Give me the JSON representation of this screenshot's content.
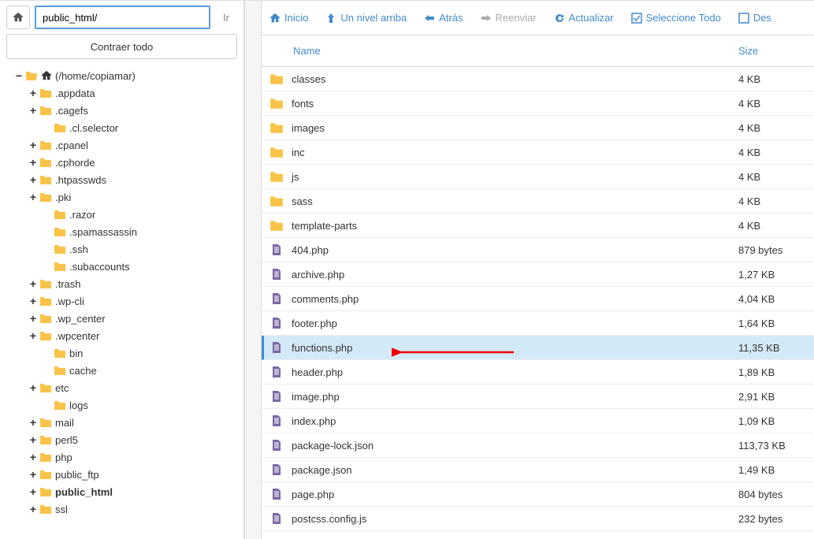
{
  "path_input": "public_html/",
  "go_label": "Ir",
  "collapse_label": "Contraer todo",
  "root_label": "(/home/copiamar)",
  "tree": [
    {
      "label": ".appdata",
      "indent": 1,
      "toggle": "+",
      "icon": "folder"
    },
    {
      "label": ".cagefs",
      "indent": 1,
      "toggle": "+",
      "icon": "folder"
    },
    {
      "label": ".cl.selector",
      "indent": 2,
      "toggle": "",
      "icon": "folder"
    },
    {
      "label": ".cpanel",
      "indent": 1,
      "toggle": "+",
      "icon": "folder"
    },
    {
      "label": ".cphorde",
      "indent": 1,
      "toggle": "+",
      "icon": "folder"
    },
    {
      "label": ".htpasswds",
      "indent": 1,
      "toggle": "+",
      "icon": "folder"
    },
    {
      "label": ".pki",
      "indent": 1,
      "toggle": "+",
      "icon": "folder"
    },
    {
      "label": ".razor",
      "indent": 2,
      "toggle": "",
      "icon": "folder"
    },
    {
      "label": ".spamassassin",
      "indent": 2,
      "toggle": "",
      "icon": "folder"
    },
    {
      "label": ".ssh",
      "indent": 2,
      "toggle": "",
      "icon": "folder"
    },
    {
      "label": ".subaccounts",
      "indent": 2,
      "toggle": "",
      "icon": "folder"
    },
    {
      "label": ".trash",
      "indent": 1,
      "toggle": "+",
      "icon": "folder"
    },
    {
      "label": ".wp-cli",
      "indent": 1,
      "toggle": "+",
      "icon": "folder"
    },
    {
      "label": ".wp_center",
      "indent": 1,
      "toggle": "+",
      "icon": "folder"
    },
    {
      "label": ".wpcenter",
      "indent": 1,
      "toggle": "+",
      "icon": "folder"
    },
    {
      "label": "bin",
      "indent": 2,
      "toggle": "",
      "icon": "folder"
    },
    {
      "label": "cache",
      "indent": 2,
      "toggle": "",
      "icon": "folder"
    },
    {
      "label": "etc",
      "indent": 1,
      "toggle": "+",
      "icon": "folder"
    },
    {
      "label": "logs",
      "indent": 2,
      "toggle": "",
      "icon": "folder"
    },
    {
      "label": "mail",
      "indent": 1,
      "toggle": "+",
      "icon": "folder"
    },
    {
      "label": "perl5",
      "indent": 1,
      "toggle": "+",
      "icon": "folder"
    },
    {
      "label": "php",
      "indent": 1,
      "toggle": "+",
      "icon": "folder"
    },
    {
      "label": "public_ftp",
      "indent": 1,
      "toggle": "+",
      "icon": "folder"
    },
    {
      "label": "public_html",
      "indent": 1,
      "toggle": "+",
      "icon": "folder",
      "bold": true
    },
    {
      "label": "ssl",
      "indent": 1,
      "toggle": "+",
      "icon": "folder"
    }
  ],
  "toolbar": {
    "inicio": "Inicio",
    "nivel": "Un nivel arriba",
    "atras": "Atrás",
    "reenviar": "Reenviar",
    "actualizar": "Actualizar",
    "seleccione": "Seleccione Todo",
    "deseleccione": "Des"
  },
  "columns": {
    "name": "Name",
    "size": "Size"
  },
  "files": [
    {
      "name": "classes",
      "size": "4 KB",
      "type": "folder"
    },
    {
      "name": "fonts",
      "size": "4 KB",
      "type": "folder"
    },
    {
      "name": "images",
      "size": "4 KB",
      "type": "folder"
    },
    {
      "name": "inc",
      "size": "4 KB",
      "type": "folder"
    },
    {
      "name": "js",
      "size": "4 KB",
      "type": "folder"
    },
    {
      "name": "sass",
      "size": "4 KB",
      "type": "folder"
    },
    {
      "name": "template-parts",
      "size": "4 KB",
      "type": "folder"
    },
    {
      "name": "404.php",
      "size": "879 bytes",
      "type": "file"
    },
    {
      "name": "archive.php",
      "size": "1,27 KB",
      "type": "file"
    },
    {
      "name": "comments.php",
      "size": "4,04 KB",
      "type": "file"
    },
    {
      "name": "footer.php",
      "size": "1,64 KB",
      "type": "file"
    },
    {
      "name": "functions.php",
      "size": "11,35 KB",
      "type": "file",
      "selected": true
    },
    {
      "name": "header.php",
      "size": "1,89 KB",
      "type": "file"
    },
    {
      "name": "image.php",
      "size": "2,91 KB",
      "type": "file"
    },
    {
      "name": "index.php",
      "size": "1,09 KB",
      "type": "file"
    },
    {
      "name": "package-lock.json",
      "size": "113,73 KB",
      "type": "file"
    },
    {
      "name": "package.json",
      "size": "1,49 KB",
      "type": "file"
    },
    {
      "name": "page.php",
      "size": "804 bytes",
      "type": "file"
    },
    {
      "name": "postcss.config.js",
      "size": "232 bytes",
      "type": "file"
    }
  ]
}
